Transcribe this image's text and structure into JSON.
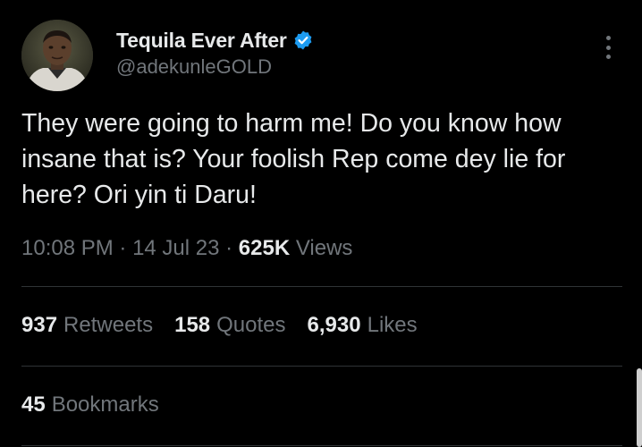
{
  "author": {
    "display_name": "Tequila Ever After",
    "handle": "@adekunleGOLD",
    "verified": true,
    "avatar_icon": "profile-photo",
    "verified_icon": "verified-badge-icon",
    "verified_color": "#1d9bf0"
  },
  "tweet": {
    "text": "They were going to harm me! Do you know how insane that is? Your foolish Rep come dey lie for here? Ori yin ti Daru!"
  },
  "meta": {
    "time": "10:08 PM",
    "separator": " · ",
    "date": "14 Jul 23",
    "views_count": "625K",
    "views_label": "Views"
  },
  "stats": {
    "retweets_count": "937",
    "retweets_label": "Retweets",
    "quotes_count": "158",
    "quotes_label": "Quotes",
    "likes_count": "6,930",
    "likes_label": "Likes",
    "bookmarks_count": "45",
    "bookmarks_label": "Bookmarks"
  },
  "colors": {
    "background": "#000000",
    "primary_text": "#e7e9ea",
    "secondary_text": "#71767b",
    "divider": "#2f3336"
  }
}
